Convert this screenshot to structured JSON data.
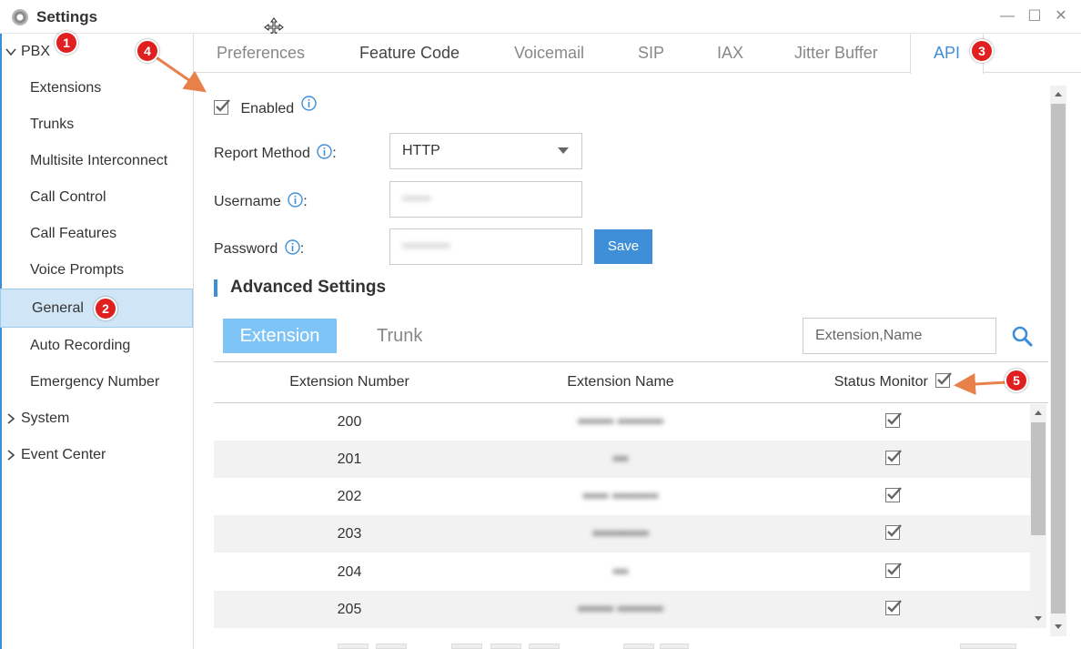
{
  "window": {
    "title": "Settings",
    "minimize": "—",
    "maximize": "☐",
    "close": "✕"
  },
  "sidebar": {
    "groups": [
      {
        "label": "PBX",
        "expanded": true
      },
      {
        "label": "System",
        "expanded": false
      },
      {
        "label": "Event Center",
        "expanded": false
      }
    ],
    "items": [
      {
        "label": "Extensions"
      },
      {
        "label": "Trunks"
      },
      {
        "label": "Multisite Interconnect"
      },
      {
        "label": "Call Control"
      },
      {
        "label": "Call Features"
      },
      {
        "label": "Voice Prompts"
      },
      {
        "label": "General",
        "active": true
      },
      {
        "label": "Auto Recording"
      },
      {
        "label": "Emergency Number"
      }
    ]
  },
  "tabs": [
    {
      "label": "Preferences"
    },
    {
      "label": "Feature Code"
    },
    {
      "label": "Voicemail"
    },
    {
      "label": "SIP"
    },
    {
      "label": "IAX"
    },
    {
      "label": "Jitter Buffer"
    },
    {
      "label": "API",
      "active": true
    }
  ],
  "api": {
    "enabled_label": "Enabled",
    "enabled": true,
    "report_method_label": "Report Method",
    "report_method_value": "HTTP",
    "username_label": "Username",
    "username_value": "••••••",
    "password_label": "Password",
    "password_value": "••••••••••",
    "colon": ":",
    "save_label": "Save"
  },
  "advanced": {
    "title": "Advanced Settings",
    "subtabs": [
      {
        "label": "Extension",
        "active": true
      },
      {
        "label": "Trunk"
      }
    ],
    "search_placeholder": "Extension,Name",
    "columns": [
      "Extension Number",
      "Extension Name",
      "Status Monitor"
    ],
    "rows": [
      {
        "number": "200",
        "name": "••••••• •••••••••",
        "monitored": true
      },
      {
        "number": "201",
        "name": "•••",
        "monitored": true
      },
      {
        "number": "202",
        "name": "••••• •••••••••",
        "monitored": true
      },
      {
        "number": "203",
        "name": "•••••••••••",
        "monitored": true
      },
      {
        "number": "204",
        "name": "•••",
        "monitored": true
      },
      {
        "number": "205",
        "name": "••••••• •••••••••",
        "monitored": true
      }
    ]
  },
  "annotations": [
    "1",
    "2",
    "3",
    "4",
    "5"
  ],
  "colors": {
    "accent": "#3e8fd8",
    "active_subtab": "#7fc4f6",
    "active_nav_bg": "#d0e6f7",
    "annotation_badge": "#e02020",
    "annotation_arrow": "#e8804a"
  }
}
